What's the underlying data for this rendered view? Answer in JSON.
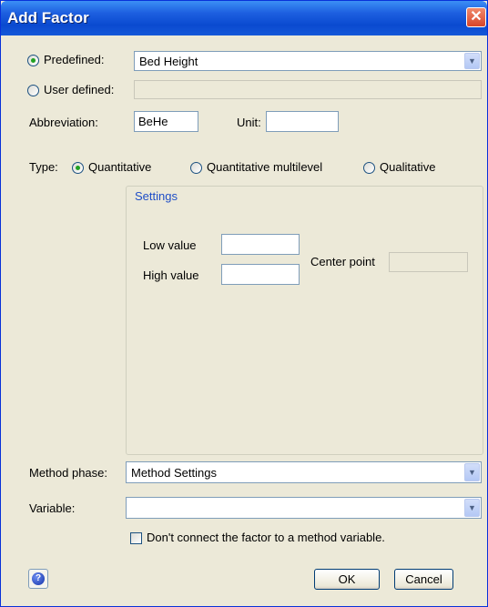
{
  "window": {
    "title": "Add Factor",
    "close_glyph": "✕"
  },
  "source": {
    "predefined_label": "Predefined:",
    "user_defined_label": "User defined:",
    "predefined_value": "Bed Height",
    "user_defined_value": "",
    "selected": "predefined"
  },
  "abbreviation": {
    "label": "Abbreviation:",
    "value": "BeHe"
  },
  "unit": {
    "label": "Unit:",
    "value": ""
  },
  "type": {
    "label": "Type:",
    "options": [
      "Quantitative",
      "Quantitative multilevel",
      "Qualitative"
    ],
    "selected": "Quantitative"
  },
  "settings": {
    "title": "Settings",
    "low_label": "Low value",
    "high_label": "High value",
    "center_label": "Center point",
    "low_value": "",
    "high_value": "",
    "center_value": ""
  },
  "method_phase": {
    "label": "Method phase:",
    "value": "Method Settings"
  },
  "variable": {
    "label": "Variable:",
    "value": ""
  },
  "dont_connect": {
    "label": "Don't connect the factor to a method variable.",
    "checked": false
  },
  "buttons": {
    "ok": "OK",
    "cancel": "Cancel"
  },
  "icons": {
    "help": "help-icon",
    "dropdown": "chevron-down-icon"
  },
  "colors": {
    "titlebar": "#0a4ad0",
    "dialog_bg": "#ece9d8",
    "radio_dot": "#21a121",
    "close": "#d8452a",
    "settings_title": "#1f4ec7"
  }
}
